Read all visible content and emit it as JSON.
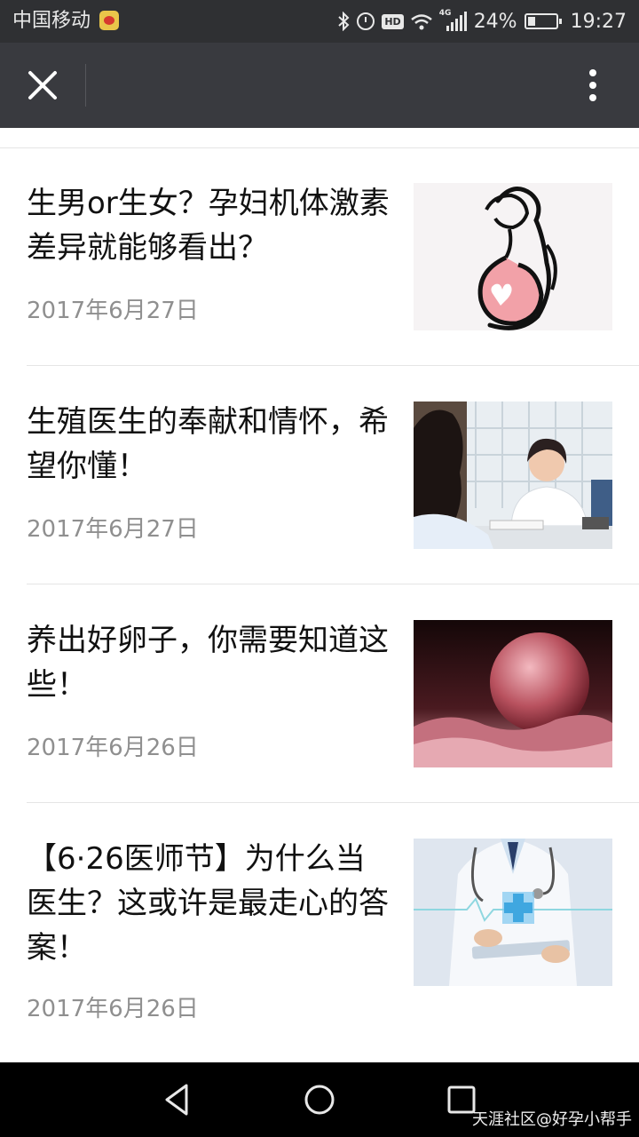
{
  "status_bar": {
    "carrier": "中国移动",
    "network": "4G",
    "battery": "24%",
    "time": "19:27",
    "hd_badge": "HD",
    "icons": [
      "weibo-icon",
      "bluetooth-icon",
      "alarm-icon",
      "hd-icon",
      "wifi-icon",
      "signal-icon",
      "battery-icon"
    ]
  },
  "title_bar": {
    "close_icon": "close-icon",
    "more_icon": "more-vertical-icon"
  },
  "articles": [
    {
      "title": "生男or生女？孕妇机体激素差异就能够看出？",
      "date": "2017年6月27日",
      "thumbnail": "pregnant-woman-illustration"
    },
    {
      "title": "生殖医生的奉献和情怀，希望你懂！",
      "date": "2017年6月27日",
      "thumbnail": "doctor-consultation-photo"
    },
    {
      "title": "养出好卵子，你需要知道这些！",
      "date": "2017年6月26日",
      "thumbnail": "egg-cell-photo"
    },
    {
      "title": "【6·26医师节】为什么当医生？这或许是最走心的答案！",
      "date": "2017年6月26日",
      "thumbnail": "doctor-medical-cross-photo"
    }
  ],
  "nav_bar": {
    "icons": [
      "back-icon",
      "home-icon",
      "recents-icon"
    ],
    "watermark": "天涯社区@好孕小帮手"
  },
  "colors": {
    "status_bar_bg": "#2f3033",
    "title_bar_bg": "#393a3f",
    "date_text": "#8f8f8f",
    "divider": "#e5e5e5"
  }
}
